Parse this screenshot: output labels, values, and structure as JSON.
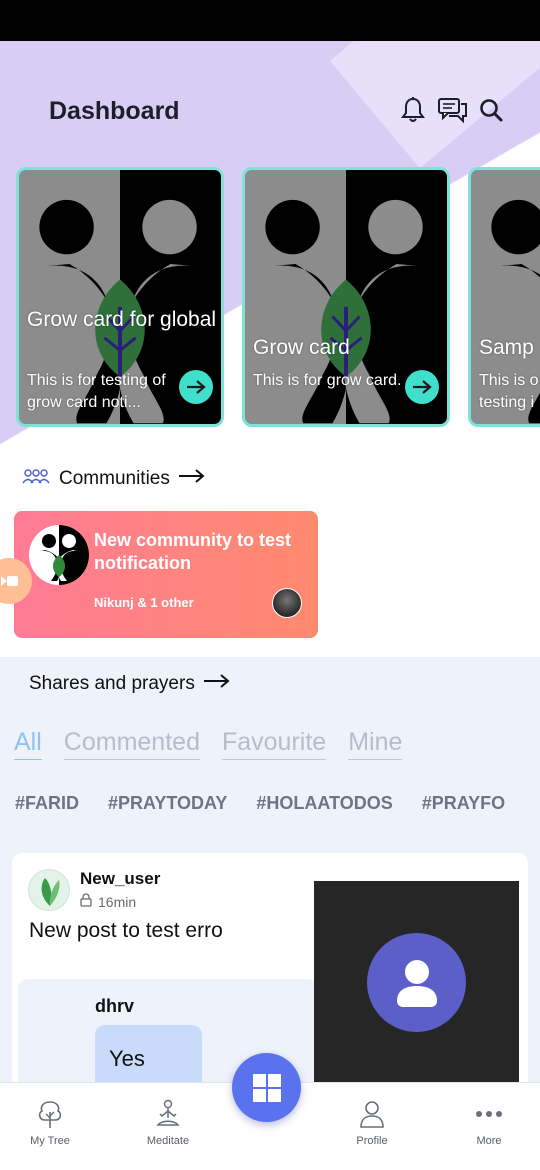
{
  "header": {
    "title": "Dashboard",
    "icons": [
      "bell-icon",
      "chat-icon",
      "search-icon"
    ]
  },
  "grow_cards": [
    {
      "title": "Grow card for global",
      "description": "This is for testing of grow card noti..."
    },
    {
      "title": "Grow card",
      "description": "This is for grow card."
    },
    {
      "title": "Samp",
      "description": "This is o testing i"
    }
  ],
  "communities": {
    "heading": "Communities",
    "card": {
      "name": "New community to test notification",
      "members": "Nikunj & 1 other"
    }
  },
  "shares": {
    "heading": "Shares and prayers",
    "tabs": [
      "All",
      "Commented",
      "Favourite",
      "Mine"
    ],
    "active_tab": "All",
    "hashtags": [
      "#FARID",
      "#PRAYTODAY",
      "#HOLAATODOS",
      "#PRAYFO"
    ]
  },
  "post": {
    "username": "New_user",
    "time": "16min",
    "text": "New post to test erro",
    "quoted_user": "dhrv",
    "quoted_text": "Yes"
  },
  "bottom_nav": {
    "items": [
      "My Tree",
      "Meditate",
      "Profile",
      "More"
    ]
  },
  "colors": {
    "accent": "#5b72ee",
    "hero_bg": "#d8cdf5",
    "card_border": "#7de3d9",
    "community_gradient_start": "#ff7b95",
    "community_gradient_end": "#ff8a6e",
    "video_avatar": "#5b5fc7",
    "active_tab": "#8fc2ee"
  }
}
